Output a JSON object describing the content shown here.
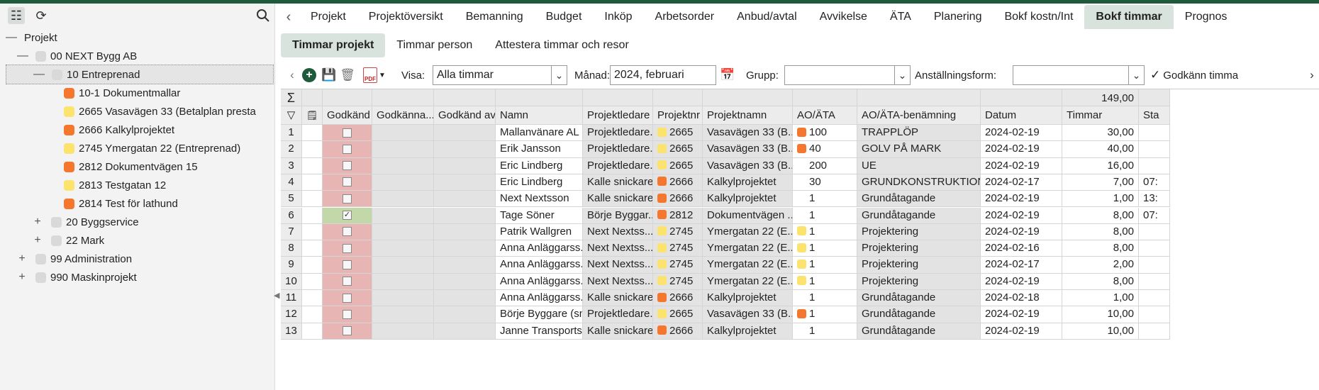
{
  "colors": {
    "accent": "#1f5a3d",
    "not_approved": "#e8b5b5",
    "approved": "#c2d8a8",
    "yellow": "#fbe36e",
    "orange": "#f5772d",
    "gray": "#d9d9d9"
  },
  "tree": {
    "root": "Projekt",
    "nodes": [
      {
        "label": "00 NEXT Bygg AB",
        "color": "gray",
        "toggle": "—"
      },
      {
        "label": "10 Entreprenad",
        "color": "gray",
        "toggle": "—"
      },
      {
        "label": "10-1 Dokumentmallar",
        "color": "orange",
        "toggle": ""
      },
      {
        "label": "2665 Vasavägen 33 (Betalplan presta",
        "color": "yellow",
        "toggle": ""
      },
      {
        "label": "2666 Kalkylprojektet",
        "color": "orange",
        "toggle": ""
      },
      {
        "label": "2745 Ymergatan 22 (Entreprenad)",
        "color": "yellow",
        "toggle": ""
      },
      {
        "label": "2812 Dokumentvägen 15",
        "color": "orange",
        "toggle": ""
      },
      {
        "label": "2813 Testgatan 12",
        "color": "yellow",
        "toggle": ""
      },
      {
        "label": "2814 Test för lathund",
        "color": "orange",
        "toggle": ""
      },
      {
        "label": "20 Byggservice",
        "color": "gray",
        "toggle": "+"
      },
      {
        "label": "22 Mark",
        "color": "gray",
        "toggle": "+"
      },
      {
        "label": "99 Administration",
        "color": "gray",
        "toggle": "+"
      },
      {
        "label": "990 Maskinprojekt",
        "color": "gray",
        "toggle": "+"
      }
    ]
  },
  "tabs": [
    "Projekt",
    "Projektöversikt",
    "Bemanning",
    "Budget",
    "Inköp",
    "Arbetsorder",
    "Anbud/avtal",
    "Avvikelse",
    "ÄTA",
    "Planering",
    "Bokf kostn/Int",
    "Bokf timmar",
    "Prognos"
  ],
  "active_tab": "Bokf timmar",
  "subtabs": [
    "Timmar projekt",
    "Timmar person",
    "Attestera timmar och resor"
  ],
  "toolbar": {
    "visa_label": "Visa:",
    "visa_value": "Alla timmar",
    "manad_label": "Månad:",
    "manad_value": "2024, februari",
    "grupp_label": "Grupp:",
    "grupp_value": "",
    "anst_label": "Anställningsform:",
    "anst_value": "",
    "approve_label": "Godkänn timma"
  },
  "grid": {
    "sum_value": "149,00",
    "columns": [
      "Godkänd",
      "Godkänna...",
      "Godkänd av",
      "Namn",
      "Projektledare",
      "Projektnr",
      "Projektnamn",
      "AO/ÄTA",
      "AO/ÄTA-benämning",
      "Datum",
      "Timmar",
      "Sta"
    ],
    "rows": [
      {
        "n": "1",
        "approved": false,
        "namn": "Mallanvänare AL",
        "pl": "Projektledare...",
        "pnr": "2665",
        "pcol": "yellow",
        "pnamn": "Vasavägen 33 (B...",
        "ao": "100",
        "aocol": "orange",
        "aoben": "TRAPPLÖP",
        "datum": "2024-02-19",
        "timmar": "30,00",
        "sta": ""
      },
      {
        "n": "2",
        "approved": false,
        "namn": "Erik Jansson",
        "pl": "Projektledare...",
        "pnr": "2665",
        "pcol": "yellow",
        "pnamn": "Vasavägen 33 (B...",
        "ao": "40",
        "aocol": "orange",
        "aoben": "GOLV PÅ MARK",
        "datum": "2024-02-19",
        "timmar": "40,00",
        "sta": ""
      },
      {
        "n": "3",
        "approved": false,
        "namn": "Eric Lindberg",
        "pl": "Projektledare...",
        "pnr": "2665",
        "pcol": "yellow",
        "pnamn": "Vasavägen 33 (B...",
        "ao": "200",
        "aocol": "",
        "aoben": "UE",
        "datum": "2024-02-19",
        "timmar": "16,00",
        "sta": ""
      },
      {
        "n": "4",
        "approved": false,
        "namn": "Eric Lindberg",
        "pl": "Kalle snickare",
        "pnr": "2666",
        "pcol": "orange",
        "pnamn": "Kalkylprojektet",
        "ao": "30",
        "aocol": "",
        "aoben": "GRUNDKONSTRUKTIONER",
        "datum": "2024-02-17",
        "timmar": "7,00",
        "sta": "07:"
      },
      {
        "n": "5",
        "approved": false,
        "namn": "Next Nextsson",
        "pl": "Kalle snickare",
        "pnr": "2666",
        "pcol": "orange",
        "pnamn": "Kalkylprojektet",
        "ao": "1",
        "aocol": "",
        "aoben": "Grundåtagande",
        "datum": "2024-02-19",
        "timmar": "1,00",
        "sta": "13:"
      },
      {
        "n": "6",
        "approved": true,
        "namn": "Tage Söner",
        "pl": "Börje Byggar...",
        "pnr": "2812",
        "pcol": "orange",
        "pnamn": "Dokumentvägen ...",
        "ao": "1",
        "aocol": "",
        "aoben": "Grundåtagande",
        "datum": "2024-02-19",
        "timmar": "8,00",
        "sta": "07:"
      },
      {
        "n": "7",
        "approved": false,
        "namn": "Patrik Wallgren",
        "pl": "Next Nextss...",
        "pnr": "2745",
        "pcol": "yellow",
        "pnamn": "Ymergatan 22 (E...",
        "ao": "1",
        "aocol": "yellow",
        "aoben": "Projektering",
        "datum": "2024-02-19",
        "timmar": "8,00",
        "sta": ""
      },
      {
        "n": "8",
        "approved": false,
        "namn": "Anna Anläggarss...",
        "pl": "Next Nextss...",
        "pnr": "2745",
        "pcol": "yellow",
        "pnamn": "Ymergatan 22 (E...",
        "ao": "1",
        "aocol": "yellow",
        "aoben": "Projektering",
        "datum": "2024-02-16",
        "timmar": "8,00",
        "sta": ""
      },
      {
        "n": "9",
        "approved": false,
        "namn": "Anna Anläggarss...",
        "pl": "Next Nextss...",
        "pnr": "2745",
        "pcol": "yellow",
        "pnamn": "Ymergatan 22 (E...",
        "ao": "1",
        "aocol": "yellow",
        "aoben": "Projektering",
        "datum": "2024-02-17",
        "timmar": "2,00",
        "sta": ""
      },
      {
        "n": "10",
        "approved": false,
        "namn": "Anna Anläggarss...",
        "pl": "Next Nextss...",
        "pnr": "2745",
        "pcol": "yellow",
        "pnamn": "Ymergatan 22 (E...",
        "ao": "1",
        "aocol": "yellow",
        "aoben": "Projektering",
        "datum": "2024-02-19",
        "timmar": "8,00",
        "sta": ""
      },
      {
        "n": "11",
        "approved": false,
        "namn": "Anna Anläggarss...",
        "pl": "Kalle snickare",
        "pnr": "2666",
        "pcol": "orange",
        "pnamn": "Kalkylprojektet",
        "ao": "1",
        "aocol": "",
        "aoben": "Grundåtagande",
        "datum": "2024-02-18",
        "timmar": "1,00",
        "sta": ""
      },
      {
        "n": "12",
        "approved": false,
        "namn": "Börje Byggare (sn...",
        "pl": "Projektledare...",
        "pnr": "2665",
        "pcol": "yellow",
        "pnamn": "Vasavägen 33 (B...",
        "ao": "1",
        "aocol": "orange",
        "aoben": "Grundåtagande",
        "datum": "2024-02-19",
        "timmar": "10,00",
        "sta": ""
      },
      {
        "n": "13",
        "approved": false,
        "namn": "Janne Transports...",
        "pl": "Kalle snickare",
        "pnr": "2666",
        "pcol": "orange",
        "pnamn": "Kalkylprojektet",
        "ao": "1",
        "aocol": "",
        "aoben": "Grundåtagande",
        "datum": "2024-02-19",
        "timmar": "10,00",
        "sta": ""
      }
    ]
  }
}
